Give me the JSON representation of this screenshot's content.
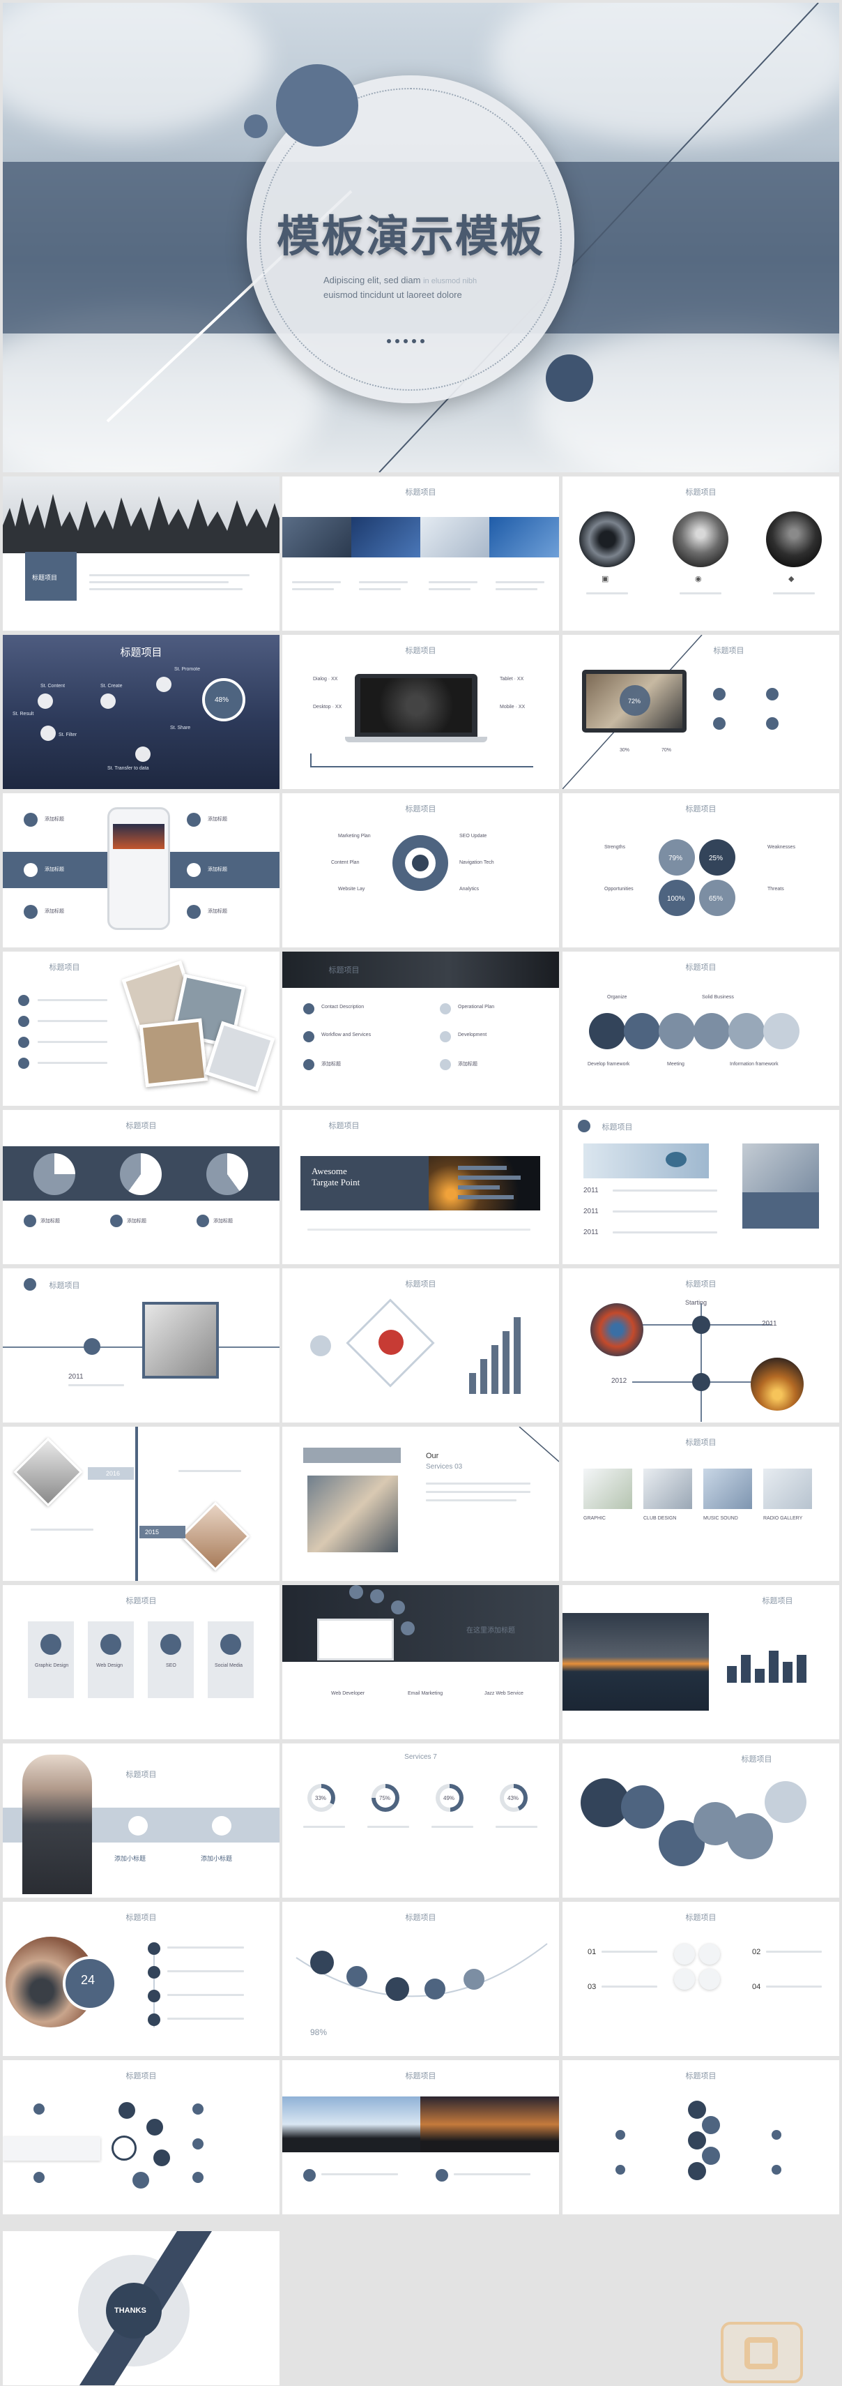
{
  "hero": {
    "title": "模板演示模板",
    "subtitle_line1": "Adipiscing elit, sed diam",
    "subtitle_line1_faint": "in elusmod nibh",
    "subtitle_line2": "euismod tincidunt ut laoreet dolore",
    "colors": {
      "accent": "#5d7390",
      "band": "#465a73"
    }
  },
  "slides": {
    "s1": {
      "tag": "标题项目"
    },
    "s2": {
      "header": "标题项目"
    },
    "s3": {
      "header": "标题项目"
    },
    "s4": {
      "title": "标题项目",
      "percent": "48%",
      "labels": [
        "St. Content",
        "St. Create",
        "St. Promote",
        "St. Filter",
        "St. Share",
        "St. Result",
        "St. Transfer to data"
      ]
    },
    "s5": {
      "header": "标题项目",
      "labels": [
        "Dialog · XX",
        "Desktop · XX",
        "Tablet · XX",
        "Mobile · XX"
      ]
    },
    "s6": {
      "header": "标题项目",
      "percent": "72%",
      "stat1": "30%",
      "stat2": "70%"
    },
    "s7": {
      "labels": [
        "添加标题",
        "添加标题",
        "添加标题",
        "添加标题",
        "添加标题",
        "添加标题"
      ]
    },
    "s8": {
      "header": "标题项目",
      "labels": [
        "Marketing Plan",
        "SEO Update",
        "Content Plan",
        "Navigation Tech",
        "Website Lay",
        "Analytics"
      ]
    },
    "s9": {
      "header": "标题项目",
      "values": [
        "79%",
        "25%",
        "100%",
        "65%"
      ],
      "labels": [
        "Strengths",
        "Weaknesses",
        "Opportunities",
        "Threats"
      ]
    },
    "s10": {
      "header": "标题项目"
    },
    "s11": {
      "header": "标题项目",
      "labels": [
        "Contact Description",
        "Operational Plan",
        "Workflow and Services",
        "Development",
        "添加标题",
        "添加标题"
      ]
    },
    "s12": {
      "header": "标题项目",
      "labels": [
        "Organize",
        "Solid Business",
        "Develop framework",
        "Meeting",
        "Information framework"
      ]
    },
    "s13": {
      "header": "标题项目",
      "labels": [
        "添加标题",
        "添加标题",
        "添加标题"
      ]
    },
    "s14": {
      "header": "标题项目",
      "title_line1": "Awesome",
      "title_line2": "Targate Point"
    },
    "s15": {
      "header": "标题项目",
      "years": [
        "2011",
        "2011",
        "2011"
      ]
    },
    "s16": {
      "header": "标题项目",
      "year": "2011"
    },
    "s17": {
      "header": "标题项目"
    },
    "s18": {
      "header": "标题项目",
      "label": "Starting",
      "years": [
        "2011",
        "2012"
      ]
    },
    "s19": {
      "years": [
        "2016",
        "2015"
      ]
    },
    "s20": {
      "title": "Our",
      "subtitle": "Services 03"
    },
    "s21": {
      "header": "标题项目",
      "labels": [
        "GRAPHIC",
        "CLUB DESIGN",
        "MUSIC SOUND",
        "RADIO GALLERY"
      ]
    },
    "s22": {
      "header": "标题项目",
      "labels": [
        "Graphic Design",
        "Web Design",
        "SEO",
        "Social Media"
      ]
    },
    "s23": {
      "title": "在这里添加标题",
      "labels": [
        "Web Developer",
        "Email Marketing",
        "Jazz Web Service"
      ]
    },
    "s24": {
      "header": "标题项目"
    },
    "s25": {
      "header": "标题项目",
      "labels": [
        "添加小标题",
        "添加小标题"
      ]
    },
    "s26": {
      "header": "Services 7",
      "values": [
        "33%",
        "75%",
        "49%",
        "43%"
      ]
    },
    "s27": {
      "header": "标题项目"
    },
    "s28": {
      "header": "标题项目",
      "number": "24"
    },
    "s29": {
      "header": "标题项目",
      "percent": "98%"
    },
    "s30": {
      "header": "标题项目",
      "numbers": [
        "01",
        "02",
        "03",
        "04"
      ]
    },
    "s31": {
      "header": "标题项目"
    },
    "s32": {
      "header": "标题项目"
    },
    "s33": {
      "header": "标题项目"
    },
    "thanks": {
      "label": "THANKS"
    }
  }
}
